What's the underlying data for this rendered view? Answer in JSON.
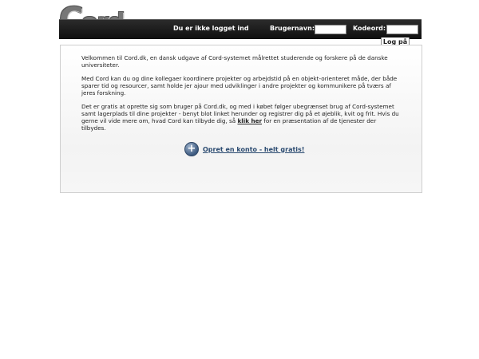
{
  "header": {
    "logo_text_big": "C",
    "logo_text_rest": "ord",
    "status": "Du er ikke logget ind",
    "username_label": "Brugernavn:",
    "password_label": "Kodeord:",
    "username_value": "",
    "password_value": "",
    "login_label": "Log på"
  },
  "main": {
    "paragraph1": "Velkommen til Cord.dk, en dansk udgave af Cord-systemet målrettet studerende og forskere på de danske universiteter.",
    "paragraph2": "Med Cord kan du og dine kollegaer koordinere projekter og arbejdstid på en objekt-orienteret måde, der både sparer tid og resourcer, samt holde jer ajour med udviklinger i andre projekter og kommunikere på tværs af jeres forskning.",
    "paragraph3_before": "Det er gratis at oprette sig som bruger på Cord.dk, og med i købet følger ubegrænset brug af Cord-systemet samt lagerplads til dine projekter - benyt blot linket herunder og registrer dig på et øjeblik, kvit og frit. Hvis du gerne vil vide mere om, hvad Cord kan tilbyde dig, så ",
    "paragraph3_link": "klik her",
    "paragraph3_after": " for en præsentation af de tjenester der tilbydes.",
    "cta_label": "Opret en konto - helt gratis!"
  }
}
